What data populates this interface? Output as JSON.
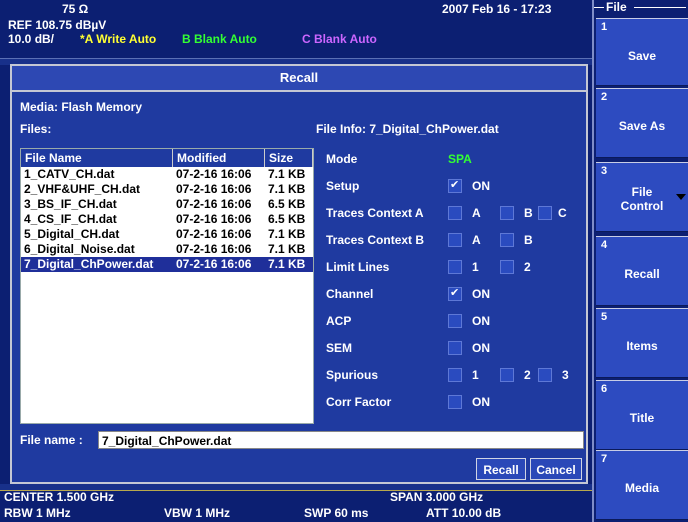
{
  "status": {
    "impedance": "75 Ω",
    "datetime": "2007 Feb 16 - 17:23",
    "ref": "REF   108.75 dBµV",
    "scale": "10.0 dB/",
    "trace_a": "*A Write Auto",
    "trace_b": "B Blank Auto",
    "trace_c": "C Blank Auto",
    "colors": {
      "trace_a": "#ffff33",
      "trace_b": "#33ff33",
      "trace_c": "#cc66ff"
    }
  },
  "dialog": {
    "title": "Recall",
    "media_label": "Media: Flash Memory",
    "files_label": "Files:",
    "columns": [
      "File Name",
      "Modified",
      "Size"
    ],
    "files": [
      {
        "name": "1_CATV_CH.dat",
        "modified": "07-2-16 16:06",
        "size": "7.1 KB"
      },
      {
        "name": "2_VHF&UHF_CH.dat",
        "modified": "07-2-16 16:06",
        "size": "7.1 KB"
      },
      {
        "name": "3_BS_IF_CH.dat",
        "modified": "07-2-16 16:06",
        "size": "6.5 KB"
      },
      {
        "name": "4_CS_IF_CH.dat",
        "modified": "07-2-16 16:06",
        "size": "6.5 KB"
      },
      {
        "name": "5_Digital_CH.dat",
        "modified": "07-2-16 16:06",
        "size": "7.1 KB"
      },
      {
        "name": "6_Digital_Noise.dat",
        "modified": "07-2-16 16:06",
        "size": "7.1 KB"
      },
      {
        "name": "7_Digital_ChPower.dat",
        "modified": "07-2-16 16:06",
        "size": "7.1 KB"
      }
    ],
    "selected_index": 6,
    "file_info_label": "File Info: 7_Digital_ChPower.dat",
    "info": {
      "mode_label": "Mode",
      "mode_value": "SPA",
      "mode_color": "#33ff33",
      "setup_label": "Setup",
      "setup_on": "ON",
      "traces_a_label": "Traces Context A",
      "ta_a": "A",
      "ta_b": "B",
      "ta_c": "C",
      "traces_b_label": "Traces Context B",
      "tb_a": "A",
      "tb_b": "B",
      "limit_label": "Limit Lines",
      "limit_1": "1",
      "limit_2": "2",
      "channel_label": "Channel",
      "channel_on": "ON",
      "acp_label": "ACP",
      "acp_on": "ON",
      "sem_label": "SEM",
      "sem_on": "ON",
      "spurious_label": "Spurious",
      "sp_1": "1",
      "sp_2": "2",
      "sp_3": "3",
      "corr_label": "Corr Factor",
      "corr_on": "ON"
    },
    "filename_label": "File name :",
    "filename_value": "7_Digital_ChPower.dat",
    "recall_button": "Recall",
    "cancel_button": "Cancel"
  },
  "bottom": {
    "center": "CENTER 1.500 GHz",
    "span": "SPAN 3.000 GHz",
    "rbw": "RBW 1 MHz",
    "vbw": "VBW 1 MHz",
    "swp": "SWP  60 ms",
    "att": "ATT 10.00 dB"
  },
  "softkeys": {
    "title": "File",
    "keys": [
      {
        "num": "1",
        "label": "Save"
      },
      {
        "num": "2",
        "label": "Save As"
      },
      {
        "num": "3",
        "label": "File",
        "label2": "Control"
      },
      {
        "num": "4",
        "label": "Recall"
      },
      {
        "num": "5",
        "label": "Items"
      },
      {
        "num": "6",
        "label": "Title"
      },
      {
        "num": "7",
        "label": "Media"
      }
    ]
  }
}
